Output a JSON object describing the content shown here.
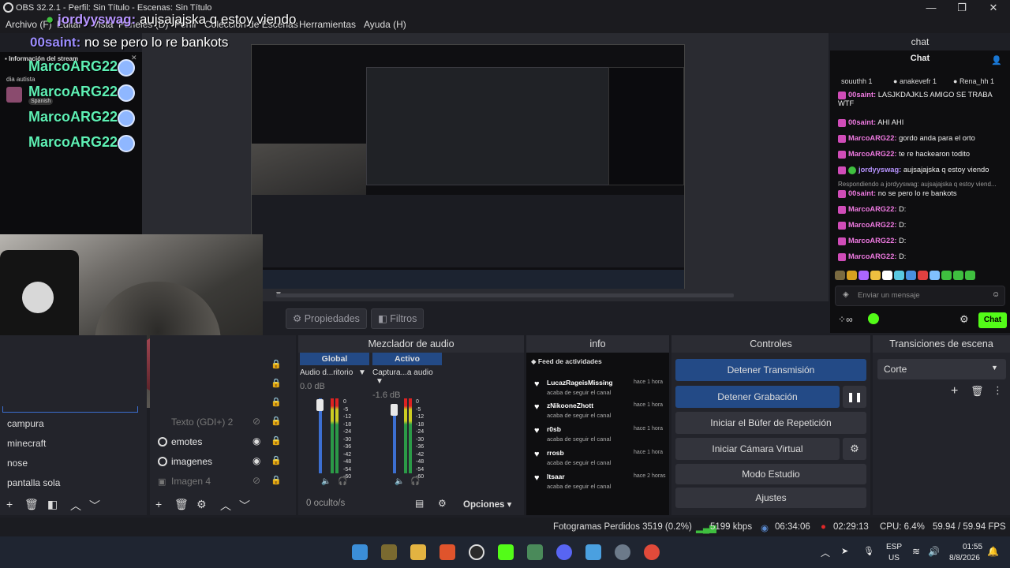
{
  "window": {
    "title": "OBS 32.2.1 - Perfil: Sin Título - Escenas: Sin Título",
    "min": "—",
    "max": "❐",
    "close": "✕"
  },
  "menu": [
    "Archivo (F)",
    "Editar",
    "Vista",
    "Paneles (D)",
    "Perfil",
    "Colección de Escenas",
    "Herramientas",
    "Ayuda (H)"
  ],
  "overlay_chat": [
    {
      "user": "jordyyswag:",
      "text": "aujsajajska q estoy viendo"
    },
    {
      "user": "00saint:",
      "text": "no se pero lo re bankots"
    }
  ],
  "stream_info": {
    "header": "Información del stream",
    "close": "✕",
    "subtitle": "dia autista",
    "language": "Spanish"
  },
  "emote_user": "MarcoARG22:",
  "preview_buttons": {
    "properties": "Propiedades",
    "filters": "Filtros"
  },
  "chat": {
    "dock_title": "chat",
    "header": "Chat",
    "leaderboard": [
      {
        "name": "souuthh",
        "count": "1"
      },
      {
        "name": "anakevefr",
        "count": "1"
      },
      {
        "name": "Rena_hh",
        "count": "1"
      }
    ],
    "messages": [
      {
        "user": "00saint:",
        "text": "LASJKDAJKLS AMIGO SE TRABA WTF",
        "color": "pink"
      },
      {
        "user": "00saint:",
        "text": "AHI AHI",
        "color": "pink"
      },
      {
        "user": "MarcoARG22:",
        "text": "gordo anda para el orto",
        "color": "pink"
      },
      {
        "user": "MarcoARG22:",
        "text": "te re hackearon todito",
        "color": "pink"
      },
      {
        "user": "jordyyswag:",
        "text": "aujsajajska q estoy viendo",
        "color": "violet"
      },
      {
        "user": "",
        "text": "Respondiendo a jordyyswag: aujsajajska q estoy viend...",
        "color": "reply"
      },
      {
        "user": "00saint:",
        "text": "no se pero lo re bankots",
        "color": "pink"
      },
      {
        "user": "MarcoARG22:",
        "text": "D:",
        "color": "pink"
      },
      {
        "user": "MarcoARG22:",
        "text": "D:",
        "color": "pink"
      },
      {
        "user": "MarcoARG22:",
        "text": "D:",
        "color": "pink"
      },
      {
        "user": "MarcoARG22:",
        "text": "D:",
        "color": "pink"
      }
    ],
    "input_placeholder": "Enviar un mensaje",
    "send_label": "Chat",
    "infinity": "∞"
  },
  "scenes": {
    "items": [
      "campura",
      "minecraft",
      "nose",
      "pantalla sola"
    ]
  },
  "sources": {
    "items": [
      {
        "name": "Texto (GDI+) 2",
        "visible": false
      },
      {
        "name": "emotes",
        "visible": true
      },
      {
        "name": "imagenes",
        "visible": true
      },
      {
        "name": "Imagen 4",
        "visible": false
      }
    ]
  },
  "mixer": {
    "title": "Mezclador de audio",
    "channels": [
      {
        "head": "Global",
        "name": "Audio d...ritorio",
        "db": "0.0 dB"
      },
      {
        "head": "Activo",
        "name": "Captura...a audio",
        "db": "-1.6 dB"
      }
    ],
    "scale": [
      "0",
      "-5",
      "-12",
      "-18",
      "-24",
      "-30",
      "-36",
      "-42",
      "-48",
      "-54",
      "-60"
    ],
    "hidden": "0 oculto/s",
    "options": "Opciones"
  },
  "info": {
    "title": "info",
    "feed_header": "Feed de actividades",
    "items": [
      {
        "name": "LucazRageisMissing",
        "desc": "acaba de seguir el canal",
        "time": "hace 1 hora"
      },
      {
        "name": "zNikooneZhott",
        "desc": "acaba de seguir el canal",
        "time": "hace 1 hora"
      },
      {
        "name": "r0sb",
        "desc": "acaba de seguir el canal",
        "time": "hace 1 hora"
      },
      {
        "name": "rrosb",
        "desc": "acaba de seguir el canal",
        "time": "hace 1 hora"
      },
      {
        "name": "ltsaar",
        "desc": "acaba de seguir el canal",
        "time": "hace 2 horas"
      }
    ]
  },
  "controls": {
    "title": "Controles",
    "stop_stream": "Detener Transmisión",
    "stop_record": "Detener Grabación",
    "replay_buffer": "Iniciar el Búfer de Repetición",
    "virtual_cam": "Iniciar Cámara Virtual",
    "studio_mode": "Modo Estudio",
    "settings": "Ajustes"
  },
  "transitions": {
    "title": "Transiciones de escena",
    "selected": "Corte"
  },
  "status": {
    "dropped": "Fotogramas Perdidos 3519 (0.2%)",
    "bitrate": "5199 kbps",
    "stream_time": "06:34:06",
    "rec_time": "02:29:13",
    "cpu": "CPU: 6.4%",
    "fps": "59.94 / 59.94 FPS"
  },
  "taskbar": {
    "lang_top": "ESP",
    "lang_bottom": "US",
    "time": "01:55",
    "date": "8/8/2026"
  },
  "colors": {
    "accent": "#234a86",
    "kick_green": "#53fc18",
    "emote_green": "#5ef0b4",
    "pink_user": "#f07ae2"
  }
}
